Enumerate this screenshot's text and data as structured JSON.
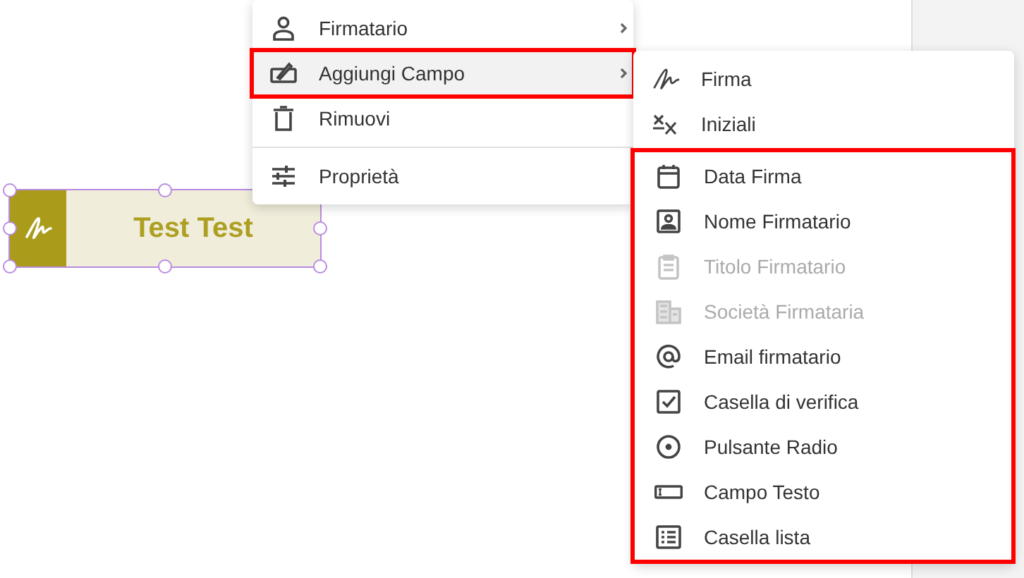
{
  "canvas": {
    "field": {
      "text": "Test Test",
      "selected": true
    }
  },
  "context_menu": {
    "items": [
      {
        "kind": "item",
        "label": "Firmatario",
        "submenu": true,
        "highlighted": false
      },
      {
        "kind": "item",
        "label": "Aggiungi Campo",
        "submenu": true,
        "highlighted": true
      },
      {
        "kind": "item",
        "label": "Rimuovi",
        "submenu": false,
        "highlighted": false
      },
      {
        "kind": "divider"
      },
      {
        "kind": "item",
        "label": "Proprietà",
        "submenu": false,
        "highlighted": false
      }
    ]
  },
  "submenu": {
    "groups": [
      {
        "highlighted": false,
        "items": [
          {
            "label": "Firma",
            "disabled": false
          },
          {
            "label": "Iniziali",
            "disabled": false
          }
        ]
      },
      {
        "highlighted": true,
        "items": [
          {
            "label": "Data Firma",
            "disabled": false
          },
          {
            "label": "Nome Firmatario",
            "disabled": false
          },
          {
            "label": "Titolo Firmatario",
            "disabled": true
          },
          {
            "label": "Società Firmataria",
            "disabled": true
          },
          {
            "label": "Email firmatario",
            "disabled": false
          },
          {
            "label": "Casella di verifica",
            "disabled": false
          },
          {
            "label": "Pulsante Radio",
            "disabled": false
          },
          {
            "label": "Campo Testo",
            "disabled": false
          },
          {
            "label": "Casella lista",
            "disabled": false
          }
        ]
      }
    ]
  }
}
